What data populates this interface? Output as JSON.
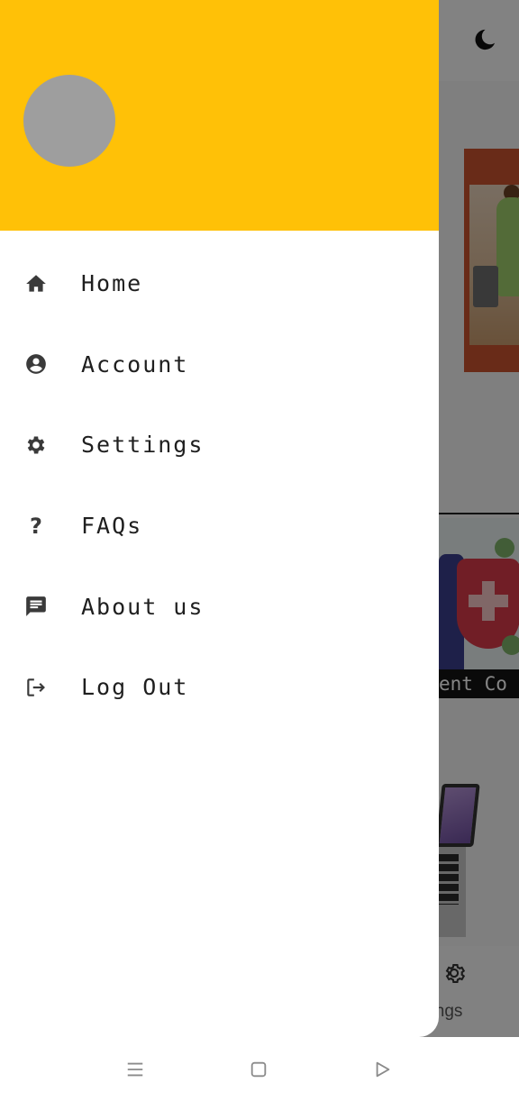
{
  "background": {
    "covid_caption": "ent Co",
    "bottom_nav_settings_label": "ttings",
    "icons": {
      "theme_toggle": "moon-icon",
      "settings": "gear-icon"
    }
  },
  "drawer": {
    "header_color": "#ffc107",
    "avatar_color": "#9e9e9e",
    "menu": [
      {
        "label": "Home",
        "icon": "home-icon"
      },
      {
        "label": "Account",
        "icon": "account-circle-icon"
      },
      {
        "label": "Settings",
        "icon": "gear-icon"
      },
      {
        "label": "FAQs",
        "icon": "question-icon",
        "glyph": "?"
      },
      {
        "label": "About us",
        "icon": "message-icon"
      },
      {
        "label": "Log Out",
        "icon": "logout-icon"
      }
    ]
  },
  "system_nav": {
    "buttons": [
      "menu-icon",
      "home-square-icon",
      "back-triangle-icon"
    ]
  }
}
